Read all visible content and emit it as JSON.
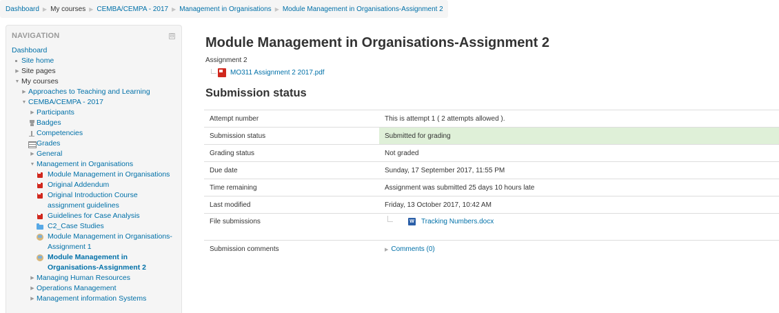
{
  "breadcrumb": {
    "items": [
      "Dashboard",
      "My courses",
      "CEMBA/CEMPA - 2017",
      "Management in Organisations",
      "Module Management in Organisations-Assignment 2"
    ]
  },
  "navigation": {
    "title": "NAVIGATION",
    "dock_glyph": "⊟",
    "dashboard": "Dashboard",
    "site_home": "Site home",
    "site_pages": "Site pages",
    "my_courses": "My courses",
    "approaches": "Approaches to Teaching and Learning",
    "cemba": "CEMBA/CEMPA - 2017",
    "participants": "Participants",
    "badges": "Badges",
    "competencies": "Competencies",
    "grades": "Grades",
    "general": "General",
    "mio": "Management in Organisations",
    "mio_items": [
      "Module Management in Organisations",
      "Original Addendum",
      "Original Introduction Course assignment guidelines",
      "Guidelines for Case Analysis",
      "C2_Case Studies",
      "Module Management in Organisations-Assignment 1",
      "Module Management in Organisations-Assignment 2"
    ],
    "managing_hr": "Managing Human Resources",
    "operations": "Operations Management",
    "mis": "Management information Systems"
  },
  "main": {
    "title": "Module Management in Organisations-Assignment 2",
    "intro_label": "Assignment 2",
    "intro_file": "MO311 Assignment 2 2017.pdf",
    "section_heading": "Submission status",
    "rows": {
      "attempt": {
        "label": "Attempt number",
        "value": "This is attempt 1 ( 2 attempts allowed )."
      },
      "submission": {
        "label": "Submission status",
        "value": "Submitted for grading"
      },
      "grading": {
        "label": "Grading status",
        "value": "Not graded"
      },
      "due": {
        "label": "Due date",
        "value": "Sunday, 17 September 2017, 11:55 PM"
      },
      "remaining": {
        "label": "Time remaining",
        "value": "Assignment was submitted 25 days 10 hours late"
      },
      "modified": {
        "label": "Last modified",
        "value": "Friday, 13 October 2017, 10:42 AM"
      },
      "files": {
        "label": "File submissions",
        "file": "Tracking Numbers.docx"
      },
      "comments": {
        "label": "Submission comments",
        "link": "Comments (0)"
      }
    }
  },
  "colors": {
    "link": "#0070a8",
    "success_bg": "#dff0d8",
    "pdf_red": "#d0281e"
  }
}
